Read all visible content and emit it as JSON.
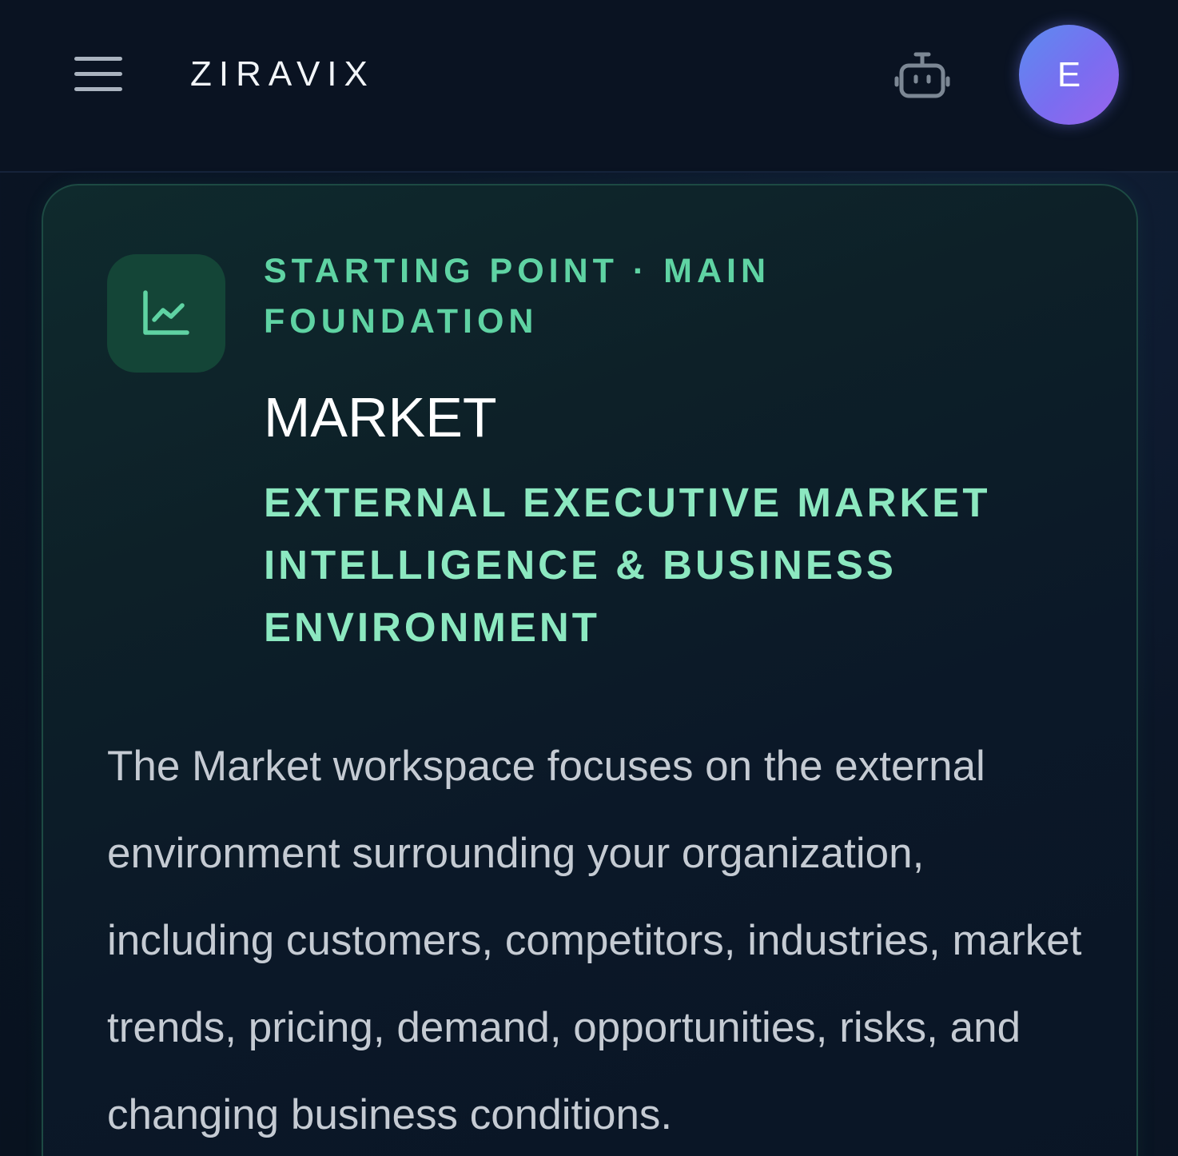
{
  "header": {
    "brand": "ZIRAVIX",
    "avatar_initial": "E",
    "menu_icon": "hamburger-menu-icon",
    "assistant_icon": "robot-icon"
  },
  "card": {
    "icon": "line-chart-icon",
    "eyebrow": "STARTING POINT · MAIN FOUNDATION",
    "title": "MARKET",
    "subtitle": "EXTERNAL EXECUTIVE MARKET INTELLIGENCE & BUSINESS ENVIRONMENT",
    "description": "The Market workspace focuses on the external environment surrounding your organization, including customers, competitors, industries, market trends, pricing, demand, opportunities, risks, and changing business conditions."
  },
  "colors": {
    "background": "#0a1322",
    "accent_green": "#5fd3a3",
    "subtitle_green": "#8ce8c0",
    "avatar_gradient_start": "#5b8cf0",
    "avatar_gradient_end": "#9a63ec",
    "icon_tile": "#144537"
  }
}
